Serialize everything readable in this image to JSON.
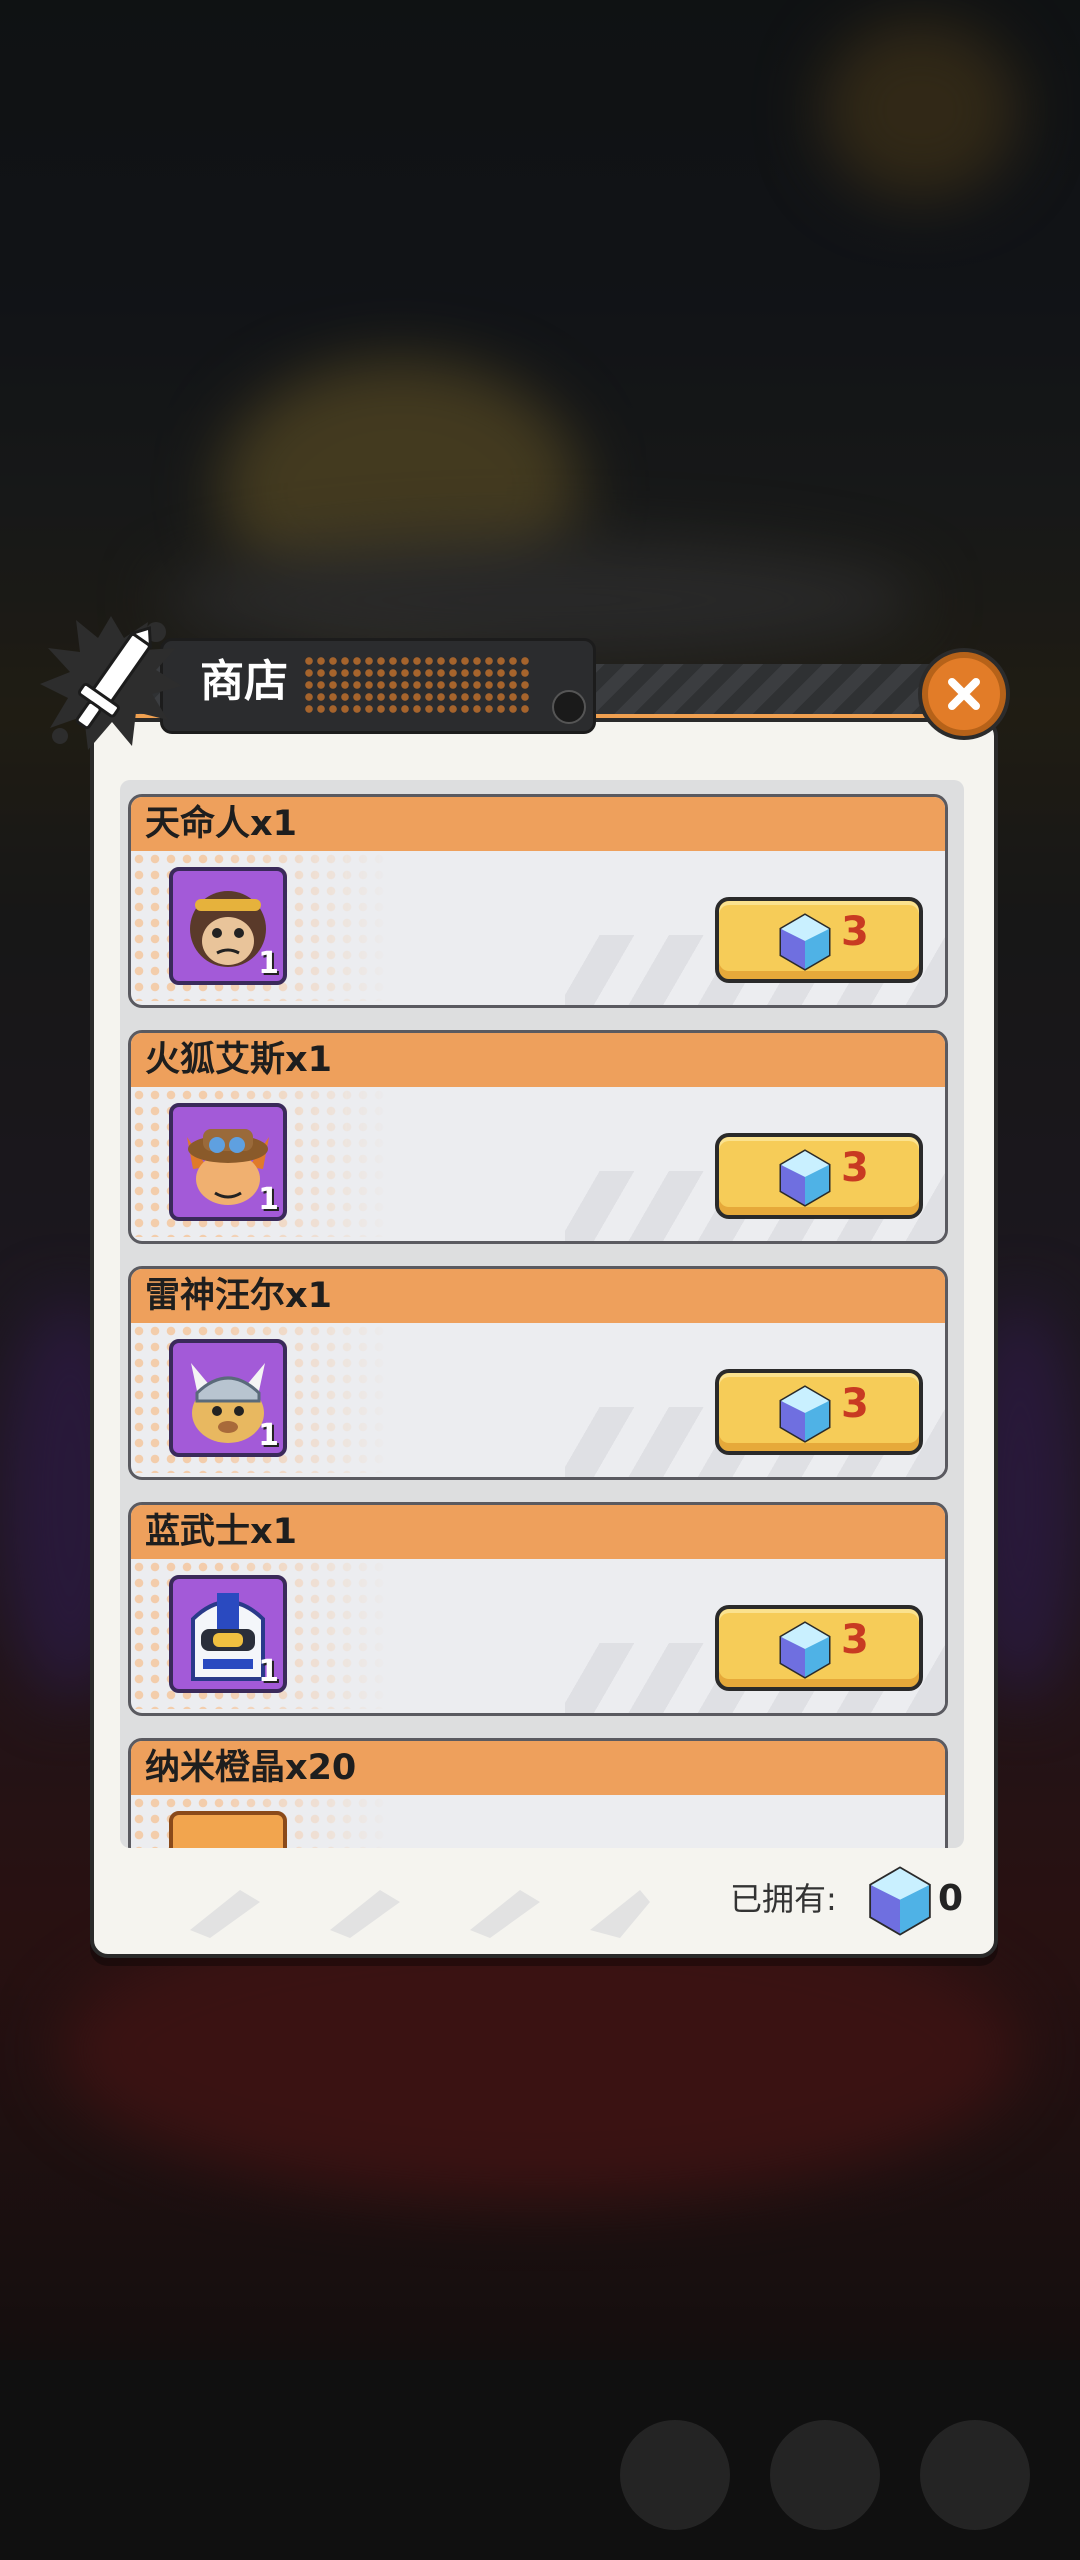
{
  "shop": {
    "title": "商店",
    "owned_label": "已拥有:",
    "owned_count": "0",
    "currency_icon": "blue-gem-icon",
    "items": [
      {
        "name": "天命人x1",
        "qty_badge": "1",
        "price": "3",
        "portrait_color": "#a35ad8"
      },
      {
        "name": "火狐艾斯x1",
        "qty_badge": "1",
        "price": "3",
        "portrait_color": "#a35ad8"
      },
      {
        "name": "雷神汪尔x1",
        "qty_badge": "1",
        "price": "3",
        "portrait_color": "#a35ad8"
      },
      {
        "name": "蓝武士x1",
        "qty_badge": "1",
        "price": "3",
        "portrait_color": "#a35ad8"
      },
      {
        "name": "纳米橙晶x20",
        "qty_badge": "",
        "price": "",
        "portrait_color": "#f2a54e"
      }
    ]
  },
  "colors": {
    "accent_orange": "#eea05c",
    "buy_button": "#f6cc58",
    "price_text": "#c83a22",
    "close_button": "#e27c28"
  }
}
